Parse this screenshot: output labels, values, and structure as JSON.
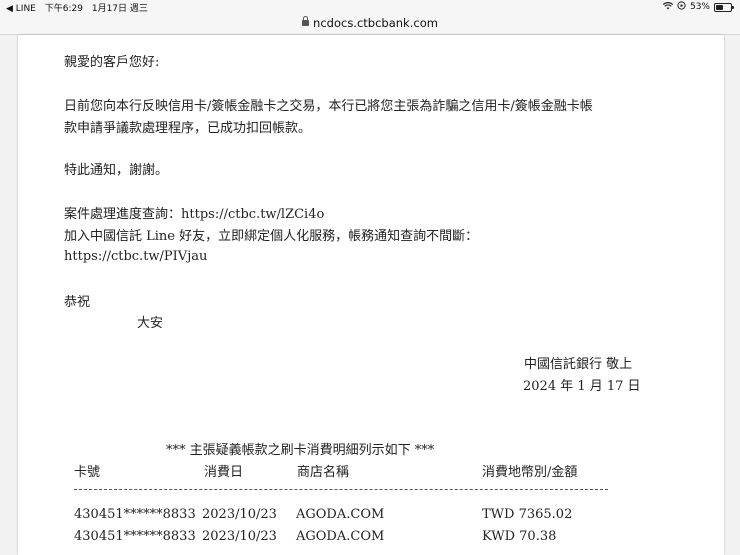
{
  "status_bar": {
    "back_app": "◀ LINE",
    "time": "下午6:29",
    "date": "1月17日 週三",
    "battery": "53%",
    "battery_level": 0.53
  },
  "browser": {
    "url": "ncdocs.ctbcbank.com"
  },
  "letter": {
    "greeting": "親愛的客戶您好:",
    "body_line1": "日前您向本行反映信用卡/簽帳金融卡之交易，本行已將您主張為詐騙之信用卡/簽帳金融卡帳",
    "body_line2": "款申請爭議款處理程序，已成功扣回帳款。",
    "notice": "特此通知，謝謝。",
    "progress_query": "案件處理進度查詢：https://ctbc.tw/lZCi4o",
    "line_add": "加入中國信託 Line 好友，立即綁定個人化服務，帳務通知查詢不間斷：",
    "line_url": "https://ctbc.tw/PIVjau",
    "closing": "恭祝",
    "closing2": "大安",
    "sender": "中國信託銀行 敬上",
    "date": "2024 年 1 月 17 日"
  },
  "table": {
    "title": "***  主張疑義帳款之刷卡消費明細列示如下  ***",
    "headers": [
      "卡號",
      "消費日",
      "商店名稱",
      "消費地幣別/金額"
    ],
    "rows": [
      [
        "430451******8833",
        "2023/10/23",
        "AGODA.COM",
        "TWD 7365.02"
      ],
      [
        "430451******8833",
        "2023/10/23",
        "AGODA.COM",
        "KWD 70.38"
      ]
    ]
  }
}
